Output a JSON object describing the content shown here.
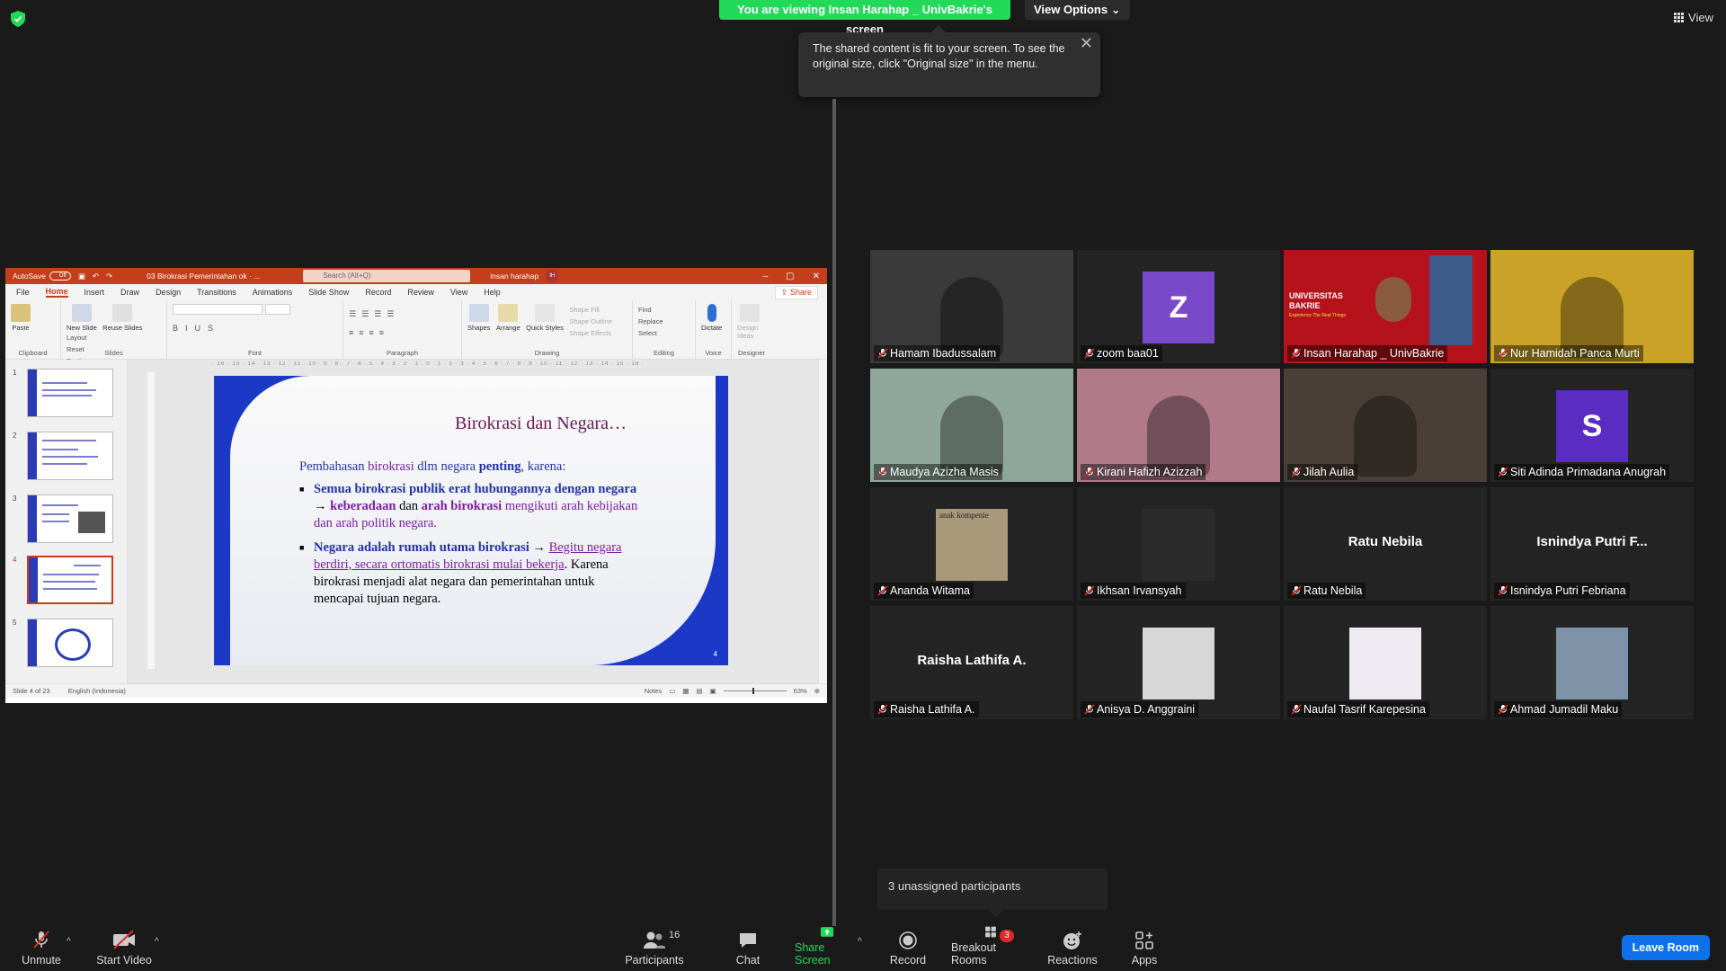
{
  "top": {
    "viewing_banner": "You are viewing Insan Harahap _ UnivBakrie's screen",
    "view_options": "View Options",
    "view_label": "View"
  },
  "tooltip": {
    "text": "The shared content is fit to your screen. To see the original size, click \"Original size\" in the menu."
  },
  "ppt": {
    "autosave": "AutoSave",
    "autosave_state": "Off",
    "filename": "03 Birokrasi Pemerintahan ok · ...",
    "search_placeholder": "Search (Alt+Q)",
    "user_name": "insan harahap",
    "user_initials": "IH",
    "tabs": [
      "File",
      "Home",
      "Insert",
      "Draw",
      "Design",
      "Transitions",
      "Animations",
      "Slide Show",
      "Record",
      "Review",
      "View",
      "Help"
    ],
    "share": "Share",
    "ribbon": {
      "clipboard": {
        "label": "Clipboard",
        "paste": "Paste"
      },
      "slides": {
        "label": "Slides",
        "new_slide": "New Slide",
        "reuse": "Reuse Slides",
        "layout": "Layout",
        "reset": "Reset",
        "section": "Section"
      },
      "font": {
        "label": "Font"
      },
      "paragraph": {
        "label": "Paragraph"
      },
      "drawing": {
        "label": "Drawing",
        "shapes": "Shapes",
        "arrange": "Arrange",
        "quick_styles": "Quick Styles",
        "shape_fill": "Shape Fill",
        "shape_outline": "Shape Outline",
        "shape_effects": "Shape Effects"
      },
      "editing": {
        "label": "Editing",
        "find": "Find",
        "replace": "Replace",
        "select": "Select"
      },
      "voice": {
        "label": "Voice",
        "dictate": "Dictate"
      },
      "designer": {
        "label": "Designer",
        "design_ideas": "Design Ideas"
      }
    },
    "thumb_numbers": [
      "1",
      "2",
      "3",
      "4",
      "5"
    ],
    "ruler": "· 16 · 15 · 14 · 13 · 12 · 11 · 10 · 9 · 8 · 7 · 6 · 5 · 4 · 3 · 2 · 1 · 0 · 1 · 2 · 3 · 4 · 5 · 6 · 7 · 8 · 9 · 10 · 11 · 12 · 13 · 14 · 15 · 16 ·",
    "slide": {
      "title": "Birokrasi dan Negara…",
      "intro_a": "Pembahasan ",
      "intro_b": "birokrasi",
      "intro_c": " dlm negara ",
      "intro_d": "penting",
      "intro_e": ", karena:",
      "b1_a": "Semua birokrasi publik erat hubungannya dengan negara",
      "b1_b": " → ",
      "b1_c": "keberadaan",
      "b1_d": " dan ",
      "b1_e": "arah birokrasi",
      "b1_f": " mengikuti arah kebijakan dan arah politik negara.",
      "b2_a": "Negara adalah rumah utama birokrasi",
      "b2_b": " → ",
      "b2_c": "Begitu negara berdiri, secara ortomatis birokrasi mulai bekerja",
      "b2_d": ". Karena birokrasi menjadi alat negara dan pemerintahan untuk mencapai tujuan negara.",
      "number": "4"
    },
    "status": {
      "slide_of": "Slide 4 of 23",
      "language": "English (Indonesia)",
      "notes": "Notes",
      "zoom": "63%"
    }
  },
  "participants": [
    {
      "name": "Hamam Ibadussalam",
      "type": "video",
      "bg": "#3a3a3a"
    },
    {
      "name": "zoom baa01",
      "type": "letter",
      "letter": "Z"
    },
    {
      "name": "Insan Harahap _ UnivBakrie",
      "type": "video",
      "bg": "#b5121b",
      "active": true,
      "overlay": "UNIVERSITAS BAKRIE",
      "overlay_sub": "Experience The Real Things"
    },
    {
      "name": "Nur Hamidah Panca Murti",
      "type": "video",
      "bg": "#c9a227"
    },
    {
      "name": "Maudya Azizha Masis",
      "type": "video",
      "bg": "#8fa79a"
    },
    {
      "name": "Kirani Hafizh Azizzah",
      "type": "video",
      "bg": "#b07a8a"
    },
    {
      "name": "Jilah Aulia",
      "type": "video",
      "bg": "#4a3f38"
    },
    {
      "name": "Siti Adinda Primadana Anugrah",
      "type": "letter",
      "letter": "S"
    },
    {
      "name": "Ananda Witama",
      "type": "photo",
      "photo_text": "anak kompenie",
      "photo_bg": "#a9987a"
    },
    {
      "name": "Ikhsan Irvansyah",
      "type": "photo",
      "photo_text": "",
      "photo_bg": "#2b2b2b"
    },
    {
      "name": "Ratu Nebila",
      "type": "name",
      "display": "Ratu Nebila"
    },
    {
      "name": "Isnindya Putri Febriana",
      "type": "name",
      "display": "Isnindya Putri F..."
    },
    {
      "name": "Raisha Lathifa A.",
      "type": "name",
      "display": "Raisha Lathifa A."
    },
    {
      "name": "Anisya D. Anggraini",
      "type": "photo",
      "photo_text": "",
      "photo_bg": "#d7d7d7"
    },
    {
      "name": "Naufal Tasrif Karepesina",
      "type": "photo",
      "photo_text": "",
      "photo_bg": "#efeaf2"
    },
    {
      "name": "Ahmad Jumadil Maku",
      "type": "photo",
      "photo_text": "",
      "photo_bg": "#7e93a8"
    }
  ],
  "unassigned": "3 unassigned participants",
  "toolbar": {
    "unmute": "Unmute",
    "start_video": "Start Video",
    "participants": "Participants",
    "participants_count": "16",
    "chat": "Chat",
    "share_screen": "Share Screen",
    "record": "Record",
    "breakout_rooms": "Breakout Rooms",
    "breakout_count": "3",
    "reactions": "Reactions",
    "apps": "Apps",
    "leave": "Leave Room"
  },
  "colors": {
    "banner_green": "#23d959",
    "leave_blue": "#0e71eb",
    "active_speaker": "#f5e642",
    "ppt_red": "#c43e1c"
  }
}
